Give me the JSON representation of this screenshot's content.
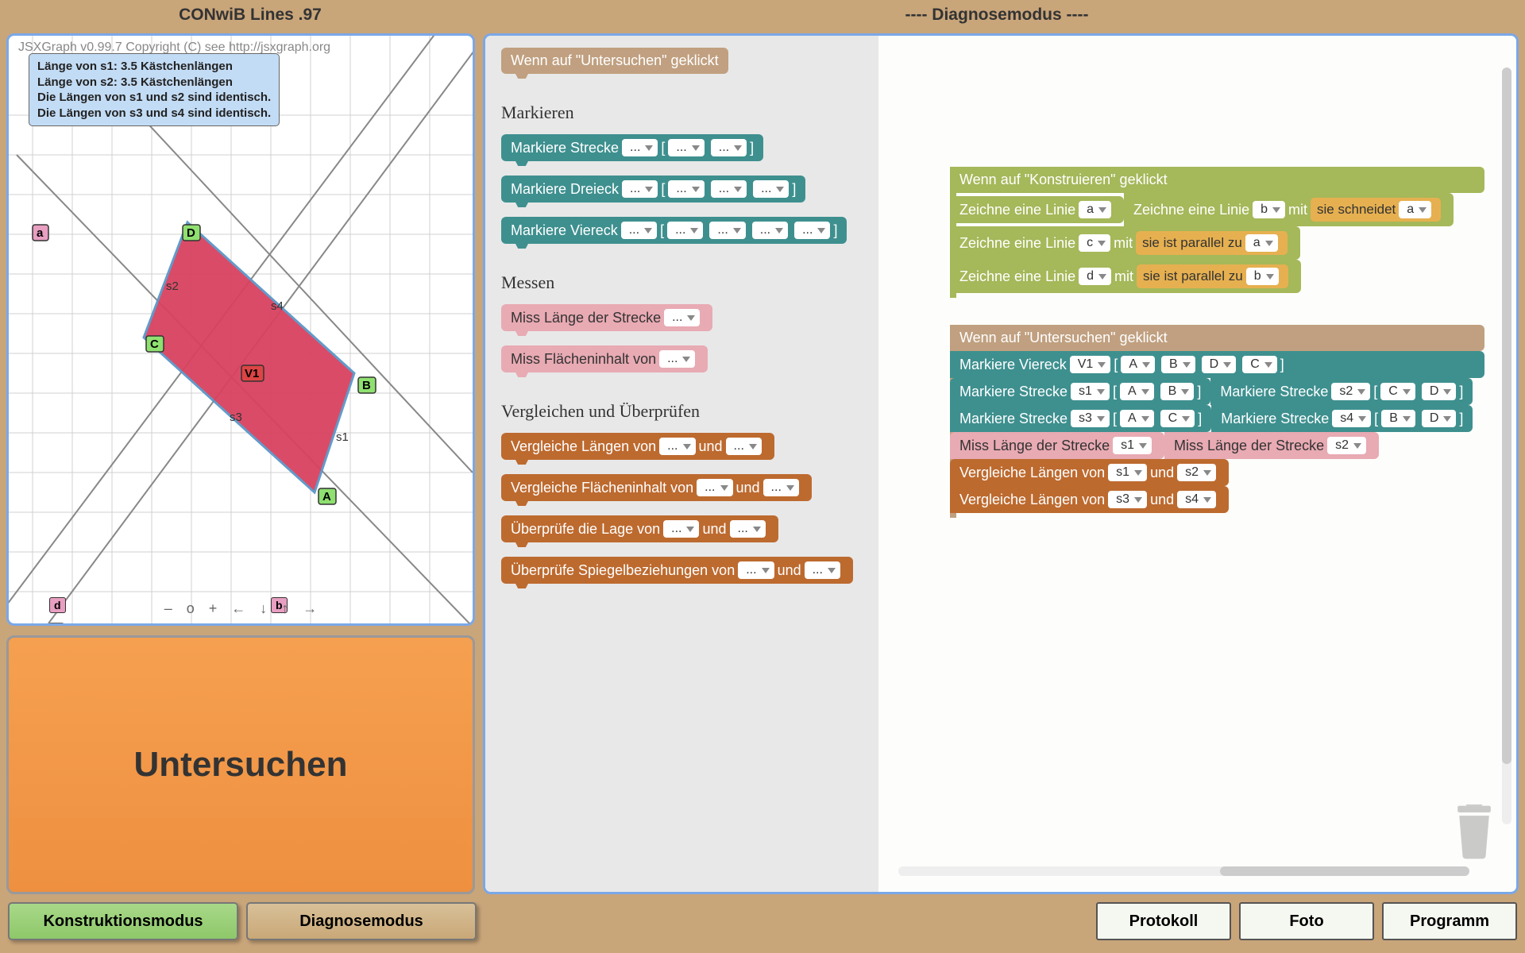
{
  "header": {
    "title": "CONwiB Lines .97",
    "mode": "---- Diagnosemodus ----"
  },
  "graph": {
    "credit": "JSXGraph v0.99.7 Copyright (C) see http://jsxgraph.org",
    "tooltip": "Länge von s1: 3.5 Kästchenlängen\nLänge von s2: 3.5 Kästchenlängen\nDie Längen von s1 und s2 sind identisch.\nDie Längen von s3 und s4 sind identisch.",
    "points": {
      "A": "A",
      "B": "B",
      "C": "C",
      "D": "D",
      "a": "a",
      "b": "b",
      "d": "d",
      "V1": "V1"
    },
    "segments": {
      "s1": "s1",
      "s2": "s2",
      "s3": "s3",
      "s4": "s4"
    },
    "nav": [
      "–",
      "o",
      "+",
      "←",
      "↓",
      "↑",
      "→"
    ]
  },
  "big_button": "Untersuchen",
  "footer": {
    "konstruktion": "Konstruktionsmodus",
    "diagnose": "Diagnosemodus",
    "protokoll": "Protokoll",
    "foto": "Foto",
    "programm": "Programm"
  },
  "palette": {
    "event_untersuchen": "Wenn auf \"Untersuchen\" geklickt",
    "sec_markieren": "Markieren",
    "markiere_strecke": "Markiere Strecke",
    "markiere_dreieck": "Markiere Dreieck",
    "markiere_viereck": "Markiere Viereck",
    "sec_messen": "Messen",
    "miss_laenge": "Miss Länge der Strecke",
    "miss_flaeche": "Miss Flächeninhalt von",
    "sec_vergleichen": "Vergleichen und Überprüfen",
    "vergleiche_laengen": "Vergleiche Längen von",
    "vergleiche_flaeche": "Vergleiche Flächeninhalt von",
    "pruefe_lage": "Überprüfe die Lage von",
    "pruefe_spiegel": "Überprüfe Spiegelbeziehungen von",
    "und": "und",
    "mit": "mit",
    "bracket_l": "[",
    "bracket_r": "]",
    "placeholder": "..."
  },
  "canvas": {
    "event_konstruieren": "Wenn auf \"Konstruieren\" geklickt",
    "zeichne_linie": "Zeichne eine Linie",
    "schneidet": "sie schneidet",
    "parallel": "sie ist parallel zu",
    "lines": [
      {
        "name": "a",
        "cond": null,
        "ref": null
      },
      {
        "name": "b",
        "cond": "sie schneidet",
        "ref": "a"
      },
      {
        "name": "c",
        "cond": "sie ist parallel zu",
        "ref": "a"
      },
      {
        "name": "d",
        "cond": "sie ist parallel zu",
        "ref": "b"
      }
    ],
    "untersuchen_program": {
      "markiere_viereck": {
        "name": "V1",
        "pts": [
          "A",
          "B",
          "D",
          "C"
        ]
      },
      "strecken": [
        {
          "name": "s1",
          "pts": [
            "A",
            "B"
          ]
        },
        {
          "name": "s2",
          "pts": [
            "C",
            "D"
          ]
        },
        {
          "name": "s3",
          "pts": [
            "A",
            "C"
          ]
        },
        {
          "name": "s4",
          "pts": [
            "B",
            "D"
          ]
        }
      ],
      "miss": [
        "s1",
        "s2"
      ],
      "vergleiche": [
        {
          "a": "s1",
          "b": "s2"
        },
        {
          "a": "s3",
          "b": "s4"
        }
      ]
    }
  }
}
